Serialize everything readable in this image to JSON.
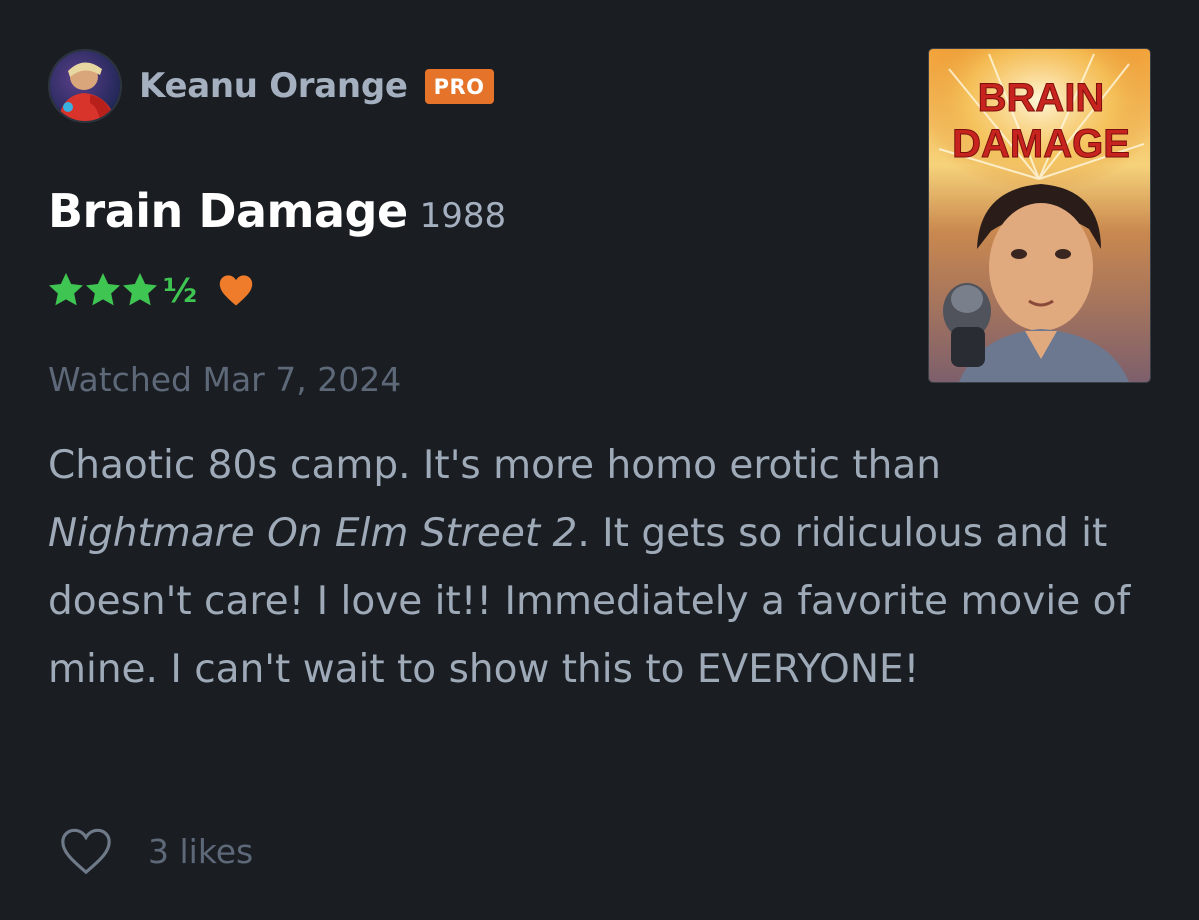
{
  "author": {
    "name": "Keanu Orange",
    "badge": "PRO"
  },
  "film": {
    "title": "Brain Damage",
    "year": "1988",
    "poster_title_line1": "BRAIN",
    "poster_title_line2": "DAMAGE"
  },
  "rating": {
    "stars": 3.5,
    "full_stars": 3,
    "half_glyph": "½",
    "liked": true
  },
  "watched_label": "Watched Mar 7, 2024",
  "review": {
    "part1": "Chaotic 80s camp. It's more homo erotic than ",
    "italic_title": "Nightmare On Elm Street 2",
    "part2": ". It gets so ridiculous and it doesn't care! I love it!! Immediately a favorite movie of mine. I can't wait to show this to EVERYONE!"
  },
  "likes": {
    "count_label": "3 likes"
  },
  "colors": {
    "background": "#1a1d22",
    "star_green": "#3fc552",
    "heart_orange": "#ee7c2b",
    "pro_orange": "#e5732a"
  },
  "icons": [
    "avatar",
    "star-icon",
    "half-star-glyph",
    "heart-icon",
    "outline-heart-icon"
  ]
}
